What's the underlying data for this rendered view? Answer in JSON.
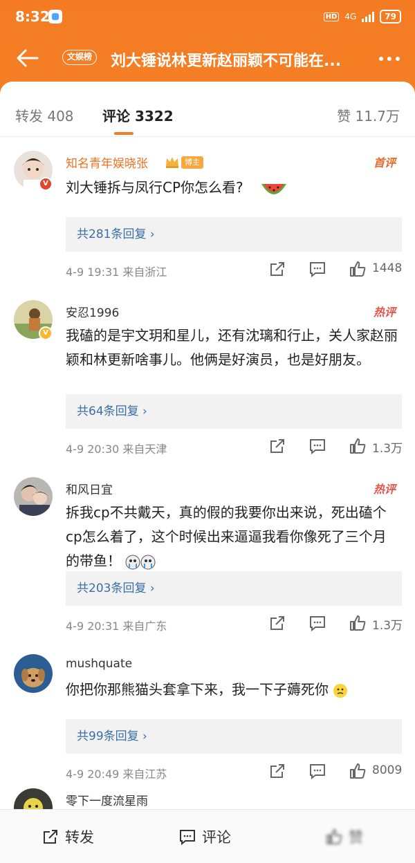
{
  "status": {
    "time": "8:32",
    "hd": "HD",
    "net": "4G",
    "battery": "79"
  },
  "nav": {
    "tag": "文娱榜",
    "title": "刘大锤说林更新赵丽颖不可能在..."
  },
  "tabs": [
    {
      "label": "转发 408"
    },
    {
      "label": "评论 3322"
    },
    {
      "label": "赞 11.7万"
    }
  ],
  "comments": [
    {
      "user": "知名青年娱晓张",
      "author_tag": "博主",
      "badge": "首评",
      "text": "刘大锤拆与凤行CP你怎么看?",
      "emoji": "watermelon-emoji",
      "replies": "共281条回复 ›",
      "meta": "4-9 19:31 来自浙江",
      "likes": "1448",
      "verified": "red"
    },
    {
      "user": "安忍1996",
      "badge": "热评",
      "text": "我磕的是宇文玥和星儿，还有沈璃和行止，关人家赵丽颖和林更新啥事儿。他俩是好演员，也是好朋友。",
      "replies": "共64条回复 ›",
      "meta": "4-9 20:30 来自天津",
      "likes": "1.3万",
      "verified": "yellow"
    },
    {
      "user": "和风日宜",
      "badge": "热评",
      "text": "拆我cp不共戴天，真的假的我要你出来说，死出磕个cp怎么着了，这个时候出来逼逼我看你像死了三个月的带鱼！",
      "emoji": "crying-emoji",
      "replies": "共203条回复 ›",
      "meta": "4-9 20:31 来自广东",
      "likes": "1.3万"
    },
    {
      "user": "mushquate",
      "text": "你把你那熊猫头套拿下来，我一下子薅死你",
      "emoji": "thinking-emoji",
      "replies": "共99条回复 ›",
      "meta": "4-9 20:49 来自江苏",
      "likes": "8009"
    },
    {
      "user": "零下一度流星雨"
    }
  ],
  "bottom": {
    "repost": "转发",
    "comment": "评论",
    "like": "赞"
  },
  "colors": {
    "accent": "#f47b23",
    "link": "#3a6ea5"
  }
}
